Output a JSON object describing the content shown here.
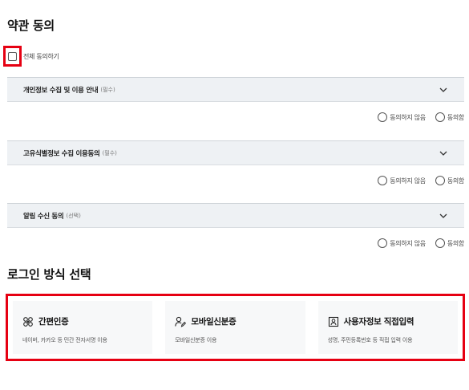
{
  "terms": {
    "title": "약관 동의",
    "all_agree_label": "전체 동의하기",
    "items": [
      {
        "title": "개인정보 수집 및 이용 안내",
        "tag": "(필수)"
      },
      {
        "title": "고유식별정보 수집 이용동의",
        "tag": "(필수)"
      },
      {
        "title": "알림 수신 동의",
        "tag": "(선택)"
      }
    ],
    "disagree_label": "동의하지 않음",
    "agree_label": "동의함"
  },
  "login": {
    "title": "로그인 방식 선택",
    "methods": [
      {
        "name": "간편인증",
        "desc": "네이버, 카카오 등 민간 전자서명 이용",
        "icon": "simple-auth-icon"
      },
      {
        "name": "모바일신분증",
        "desc": "모바일신분증 이용",
        "icon": "mobile-id-icon"
      },
      {
        "name": "사용자정보 직접입력",
        "desc": "성명, 주민등록번호 등 직접 입력 이용",
        "icon": "user-card-icon"
      }
    ]
  },
  "colors": {
    "highlight": "#e60012",
    "accordion_bg": "#eef1f4",
    "card_bg": "#f7f8f9"
  }
}
